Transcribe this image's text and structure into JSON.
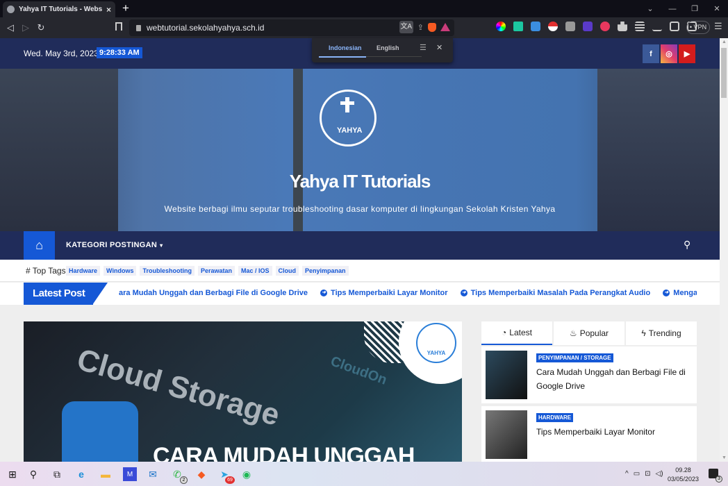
{
  "browser": {
    "tab_title": "Yahya IT Tutorials - Website berbagi",
    "tab_close": "×",
    "new_tab": "+",
    "url": "webtutorial.sekolahyahya.sch.id",
    "vpn_label": "• VPN",
    "window_controls": {
      "dropdown": "⌄",
      "minimize": "—",
      "restore": "❐",
      "close": "✕"
    },
    "nav": {
      "back": "◁",
      "forward": "▷",
      "reload": "↻"
    },
    "translate_icon": "文A",
    "share_icon": "⇪",
    "menu_icon": "☰"
  },
  "translate_popup": {
    "lang_source": "Indonesian",
    "lang_target": "English",
    "menu_icon": "☰",
    "close_icon": "✕"
  },
  "topbar": {
    "date": "Wed. May 3rd, 2023",
    "time": "9:28:33 AM",
    "social": [
      {
        "name": "facebook",
        "glyph": "f",
        "color": "#3b5998"
      },
      {
        "name": "instagram",
        "glyph": "◎",
        "color": "#e23d6a"
      },
      {
        "name": "youtube",
        "glyph": "▶",
        "color": "#d31c1c"
      }
    ]
  },
  "hero": {
    "logo_text": "YAHYA",
    "title": "Yahya IT Tutorials",
    "description": "Website berbagi ilmu seputar troubleshooting dasar komputer di lingkungan Sekolah Kristen Yahya"
  },
  "mainnav": {
    "home_icon": "⌂",
    "category_label": "KATEGORI POSTINGAN",
    "caret": "▾",
    "search_icon": "⚲"
  },
  "tags": {
    "label": "# Top Tags",
    "items": [
      "Hardware",
      "Windows",
      "Troubleshooting",
      "Perawatan",
      "Mac / IOS",
      "Cloud",
      "Penyimpanan"
    ]
  },
  "latest_post": {
    "label": "Latest Post",
    "ticker": [
      "ara Mudah Unggah dan Berbagi File di Google Drive",
      "Tips Memperbaiki Layar Monitor",
      "Tips Memperbaiki Masalah Pada Perangkat Audio",
      "Mengatasi Keyboard dan Mo"
    ]
  },
  "featured": {
    "image_text": "Cloud Storage",
    "image_sub": "CloudOn",
    "logo_text": "YAHYA",
    "headline": "CARA MUDAH UNGGAH"
  },
  "sidebar": {
    "tabs": [
      {
        "icon": "◔",
        "label": "Latest"
      },
      {
        "icon": "♨",
        "label": "Popular"
      },
      {
        "icon": "ϟ",
        "label": "Trending"
      }
    ],
    "posts": [
      {
        "category": "PENYIMPANAN / STORAGE",
        "title": "Cara Mudah Unggah dan Berbagi File di Google Drive"
      },
      {
        "category": "HARDWARE",
        "title": "Tips Memperbaiki Layar Monitor"
      }
    ]
  },
  "taskbar": {
    "start": "⊞",
    "search": "⚲",
    "taskview": "⧉",
    "apps": [
      {
        "name": "edge",
        "glyph": "e",
        "color": "#1b8fd8"
      },
      {
        "name": "file-explorer",
        "glyph": "▬",
        "color": "#f4b73b"
      },
      {
        "name": "app-ma",
        "glyph": "M",
        "color": "#3a4bd8"
      },
      {
        "name": "mail",
        "glyph": "✉",
        "color": "#1a73c8"
      },
      {
        "name": "whatsapp",
        "glyph": "✆",
        "color": "#2bb741",
        "badge": "2"
      },
      {
        "name": "brave",
        "glyph": "◆",
        "color": "#f55a22"
      },
      {
        "name": "telegram",
        "glyph": "➤",
        "color": "#2aa3df",
        "badge": "69"
      },
      {
        "name": "spotify",
        "glyph": "◉",
        "color": "#1db954"
      }
    ],
    "tray": [
      "^",
      "▭",
      "⊡",
      "◁)"
    ],
    "time": "09.28",
    "date": "03/05/2023",
    "notifications": "3"
  }
}
